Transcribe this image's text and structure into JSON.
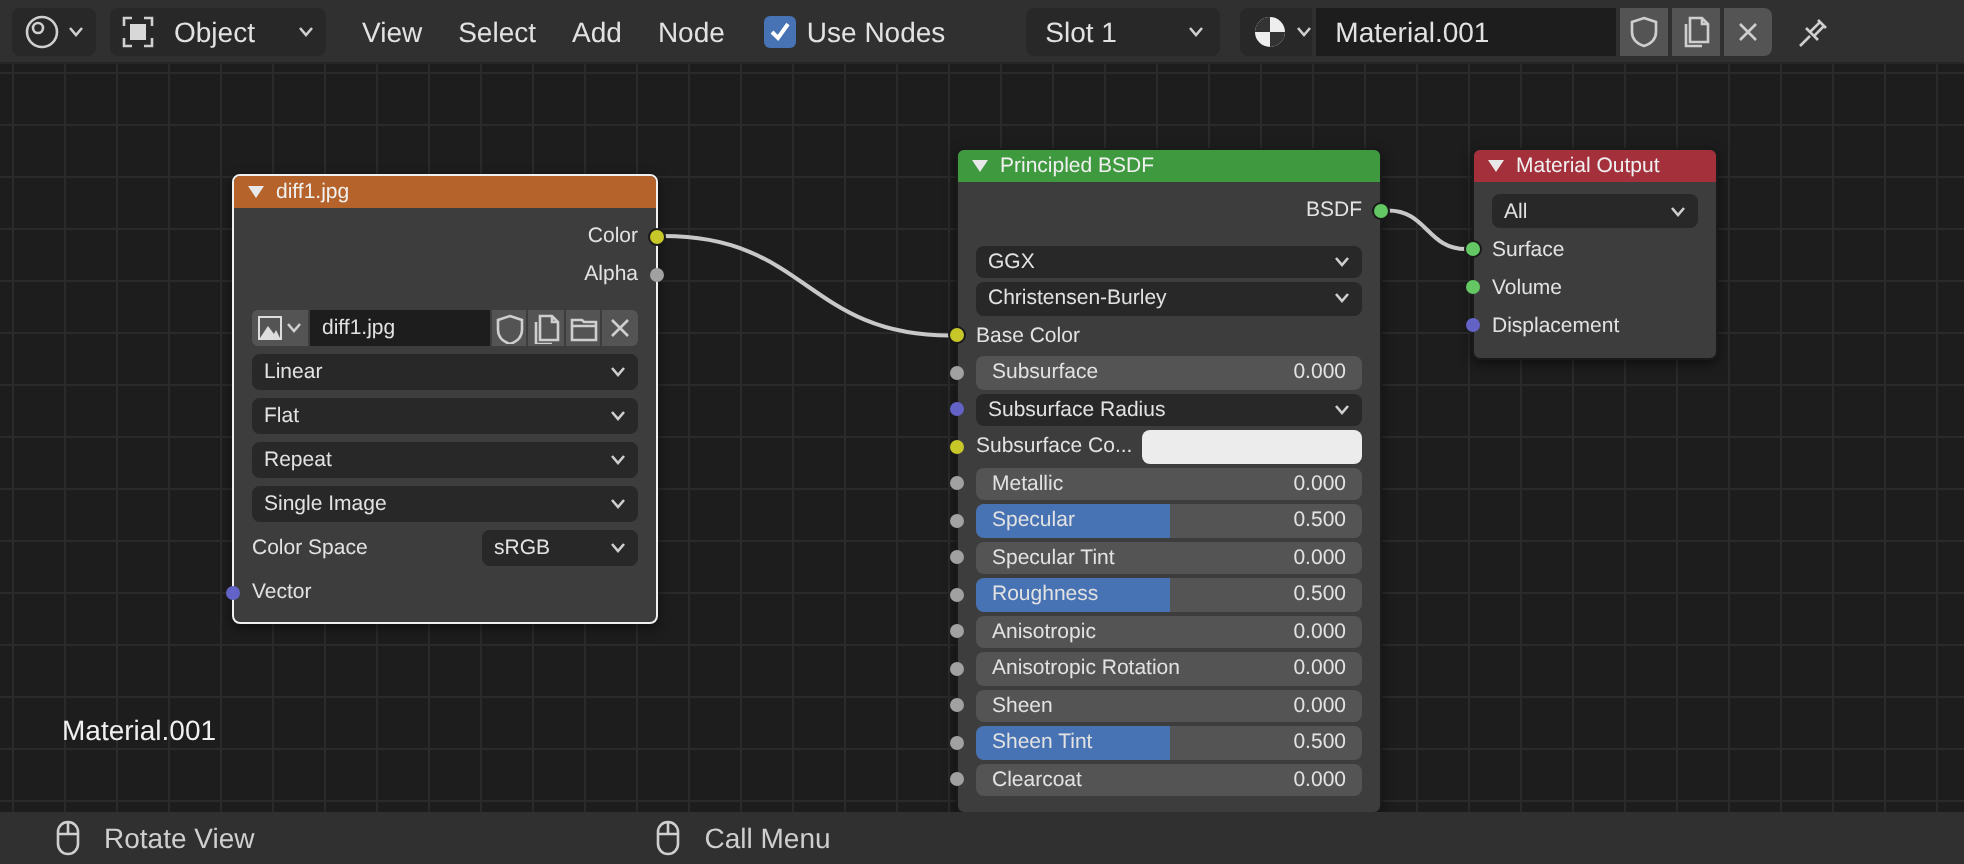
{
  "header": {
    "mode": "Object",
    "menus": [
      "View",
      "Select",
      "Add",
      "Node"
    ],
    "use_nodes": {
      "label": "Use Nodes",
      "checked": true
    },
    "slot": "Slot 1",
    "material": "Material.001"
  },
  "nodes": [
    {
      "title": "diff1.jpg",
      "color": "#b5632b",
      "selected": true,
      "rows": [
        {
          "kind": "output",
          "label": "Color",
          "color": "#c7c729",
          "connected": true
        },
        {
          "kind": "output",
          "label": "Alpha",
          "color": "#a1a1a1",
          "connected": false
        },
        {
          "kind": "image_field",
          "value": "diff1.jpg"
        },
        {
          "kind": "dropdown",
          "value": "Linear"
        },
        {
          "kind": "dropdown",
          "value": "Flat"
        },
        {
          "kind": "dropdown",
          "value": "Repeat"
        },
        {
          "kind": "dropdown",
          "value": "Single Image"
        },
        {
          "kind": "labeled_dropdown",
          "label": "Color Space",
          "value": "sRGB"
        },
        {
          "kind": "input",
          "label": "Vector",
          "color": "#6363c7",
          "connected": false
        }
      ]
    },
    {
      "title": "Principled BSDF",
      "color": "#3f9a3f",
      "selected": false,
      "rows": [
        {
          "kind": "output",
          "label": "BSDF",
          "color": "#63c763",
          "connected": true
        },
        {
          "kind": "dropdown",
          "value": "GGX"
        },
        {
          "kind": "dropdown",
          "value": "Christensen-Burley"
        },
        {
          "kind": "input",
          "label": "Base Color",
          "color": "#c7c729",
          "connected": true
        },
        {
          "kind": "slider",
          "label": "Subsurface",
          "value": "0.000",
          "level": 0,
          "color": "#a1a1a1",
          "connected": false
        },
        {
          "kind": "socket_dropdown",
          "value": "Subsurface Radius",
          "color": "#6363c7",
          "connected": false
        },
        {
          "kind": "color_input",
          "label": "Subsurface Co...",
          "swatch": {
            "color": "#ececec"
          },
          "color": "#c7c729",
          "connected": false
        },
        {
          "kind": "slider",
          "label": "Metallic",
          "value": "0.000",
          "level": 0,
          "color": "#a1a1a1",
          "connected": false
        },
        {
          "kind": "slider",
          "label": "Specular",
          "value": "0.500",
          "level": 0.5,
          "color": "#a1a1a1",
          "connected": false
        },
        {
          "kind": "slider",
          "label": "Specular Tint",
          "value": "0.000",
          "level": 0,
          "color": "#a1a1a1",
          "connected": false
        },
        {
          "kind": "slider",
          "label": "Roughness",
          "value": "0.500",
          "level": 0.5,
          "color": "#a1a1a1",
          "connected": false
        },
        {
          "kind": "slider",
          "label": "Anisotropic",
          "value": "0.000",
          "level": 0,
          "color": "#a1a1a1",
          "connected": false
        },
        {
          "kind": "slider",
          "label": "Anisotropic Rotation",
          "value": "0.000",
          "level": 0,
          "color": "#a1a1a1",
          "connected": false
        },
        {
          "kind": "slider",
          "label": "Sheen",
          "value": "0.000",
          "level": 0,
          "color": "#a1a1a1",
          "connected": false
        },
        {
          "kind": "slider",
          "label": "Sheen Tint",
          "value": "0.500",
          "level": 0.5,
          "color": "#a1a1a1",
          "connected": false
        },
        {
          "kind": "slider",
          "label": "Clearcoat",
          "value": "0.000",
          "level": 0,
          "color": "#a1a1a1",
          "connected": false
        }
      ]
    },
    {
      "title": "Material Output",
      "color": "#a3303b",
      "selected": false,
      "rows": [
        {
          "kind": "dropdown",
          "value": "All"
        },
        {
          "kind": "input",
          "label": "Surface",
          "color": "#63c763",
          "connected": true
        },
        {
          "kind": "input",
          "label": "Volume",
          "color": "#63c763",
          "connected": false
        },
        {
          "kind": "input",
          "label": "Displacement",
          "color": "#6363c7",
          "connected": false
        }
      ]
    }
  ],
  "canvas_label": "Material.001",
  "status_bar": [
    {
      "label": "Rotate View"
    },
    {
      "label": "Call Menu"
    }
  ]
}
